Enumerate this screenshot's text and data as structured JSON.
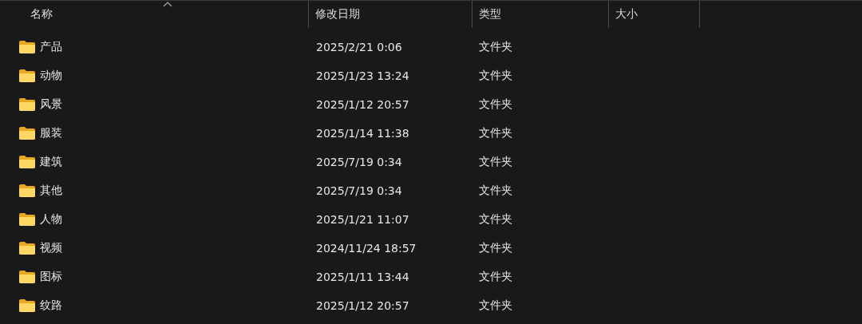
{
  "table": {
    "columns": [
      {
        "label": "名称",
        "sorted": true
      },
      {
        "label": "修改日期",
        "sorted": false
      },
      {
        "label": "类型",
        "sorted": false
      },
      {
        "label": "大小",
        "sorted": false
      }
    ],
    "rows": [
      {
        "name": "产品",
        "modified": "2025/2/21 0:06",
        "type": "文件夹"
      },
      {
        "name": "动物",
        "modified": "2025/1/23 13:24",
        "type": "文件夹"
      },
      {
        "name": "风景",
        "modified": "2025/1/12 20:57",
        "type": "文件夹"
      },
      {
        "name": "服装",
        "modified": "2025/1/14 11:38",
        "type": "文件夹"
      },
      {
        "name": "建筑",
        "modified": "2025/7/19 0:34",
        "type": "文件夹"
      },
      {
        "name": "其他",
        "modified": "2025/7/19 0:34",
        "type": "文件夹"
      },
      {
        "name": "人物",
        "modified": "2025/1/21 11:07",
        "type": "文件夹"
      },
      {
        "name": "视频",
        "modified": "2024/11/24 18:57",
        "type": "文件夹"
      },
      {
        "name": "图标",
        "modified": "2025/1/11 13:44",
        "type": "文件夹"
      },
      {
        "name": "纹路",
        "modified": "2025/1/12 20:57",
        "type": "文件夹"
      }
    ]
  }
}
